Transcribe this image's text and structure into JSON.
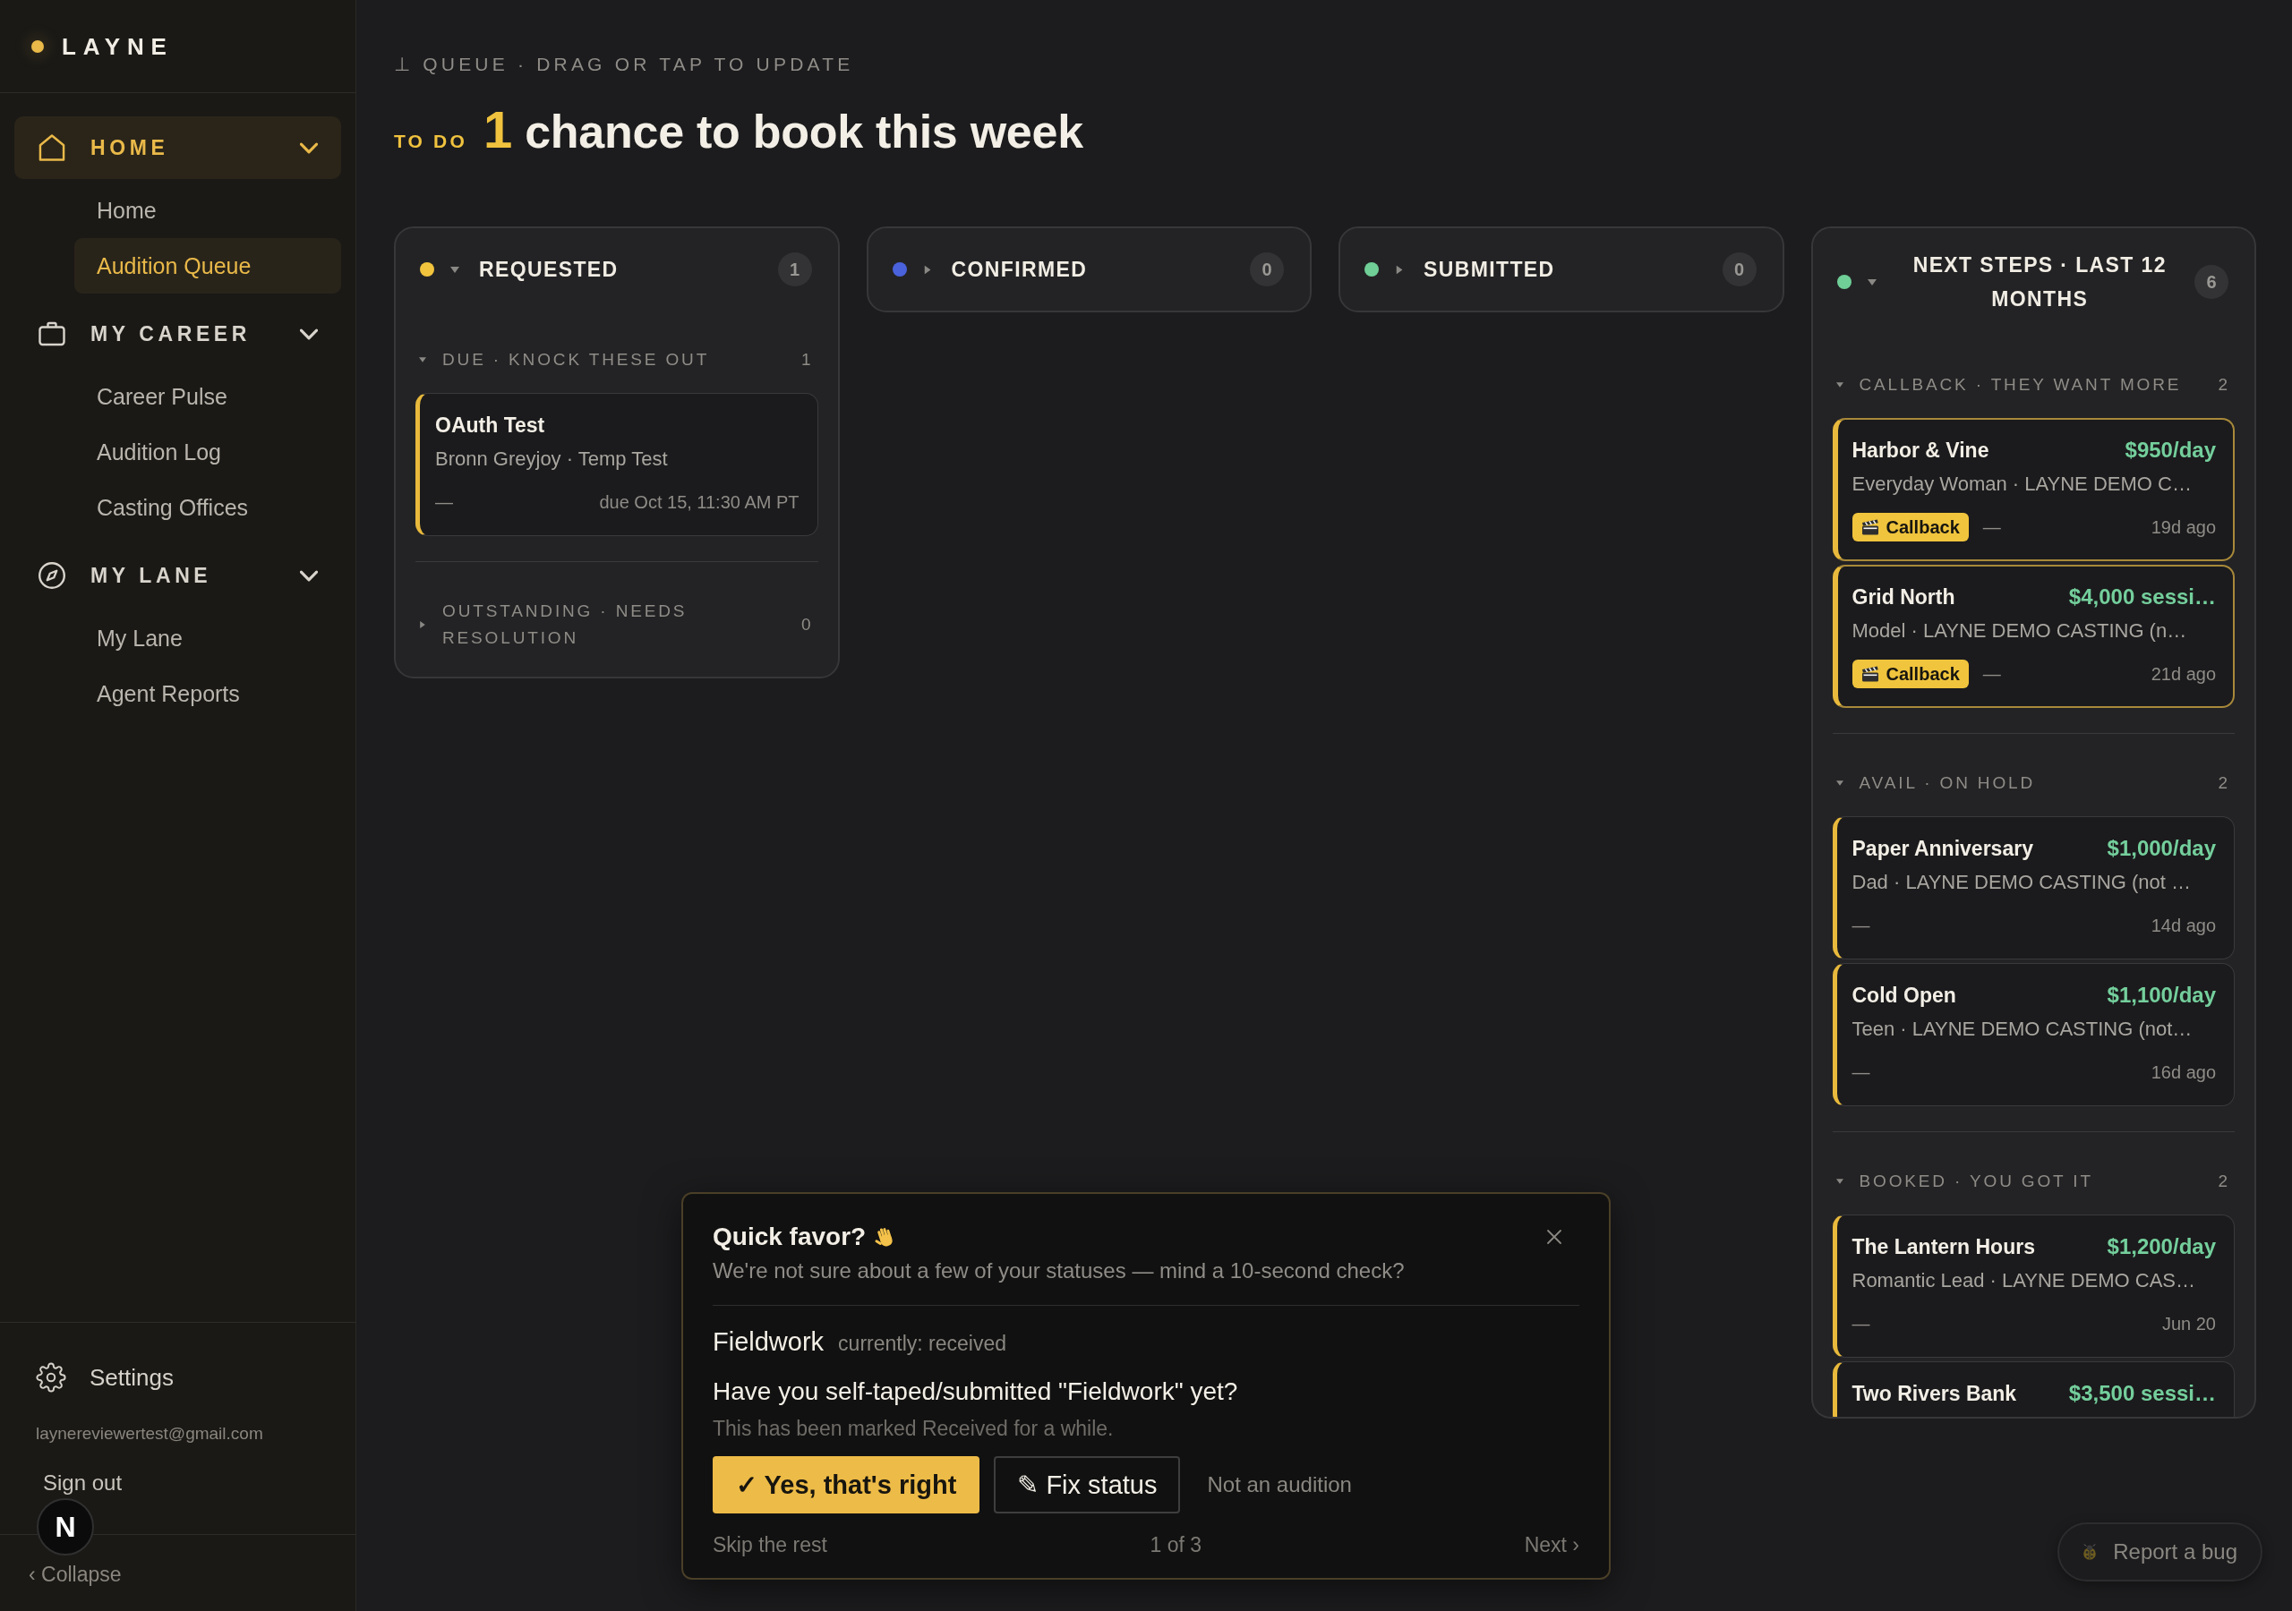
{
  "sidebar": {
    "brand": "LAYNE",
    "groups": [
      {
        "label": "HOME",
        "active": true,
        "expanded": true,
        "items": [
          {
            "label": "Home",
            "selected": false
          },
          {
            "label": "Audition Queue",
            "selected": true
          }
        ]
      },
      {
        "label": "MY CAREER",
        "active": false,
        "expanded": true,
        "items": [
          {
            "label": "Career Pulse",
            "selected": false
          },
          {
            "label": "Audition Log",
            "selected": false
          },
          {
            "label": "Casting Offices",
            "selected": false
          }
        ]
      },
      {
        "label": "MY LANE",
        "active": false,
        "expanded": true,
        "items": [
          {
            "label": "My Lane",
            "selected": false
          },
          {
            "label": "Agent Reports",
            "selected": false
          }
        ]
      }
    ],
    "settings": "Settings",
    "email": "laynereviewertest@gmail.com",
    "sign_out": "Sign out",
    "collapse": "‹ Collapse"
  },
  "queue": {
    "eyebrow": "⊥ QUEUE · DRAG OR TAP TO UPDATE",
    "todo_label": "TO DO",
    "count": "1",
    "headline": "chance to book this week",
    "columns": [
      {
        "title": "REQUESTED",
        "color": "#f2c43d",
        "expanded": true,
        "count": "1",
        "sections": [
          {
            "label": "DUE · KNOCK THESE OUT",
            "count": "1",
            "expanded": true,
            "cards": [
              {
                "title": "OAuth Test",
                "subtitle": "Bronn Greyjoy · Temp Test",
                "note": "—",
                "time": "due Oct 15, 11:30 AM PT",
                "highlighted": false
              }
            ]
          },
          {
            "label": "OUTSTANDING · NEEDS RESOLUTION",
            "count": "0",
            "expanded": false
          }
        ]
      },
      {
        "title": "CONFIRMED",
        "color": "#4a62dc",
        "expanded": false,
        "count": "0"
      },
      {
        "title": "SUBMITTED",
        "color": "#6fcf97",
        "expanded": false,
        "count": "0"
      },
      {
        "title": "NEXT STEPS · LAST 12 MONTHS",
        "color": "#6fcf97",
        "expanded": true,
        "count": "6",
        "sections": [
          {
            "label": "CALLBACK · THEY WANT MORE",
            "count": "2",
            "expanded": true,
            "cards": [
              {
                "title": "Harbor & Vine",
                "rate": "$950/day",
                "subtitle": "Everyday Woman · LAYNE DEMO C…",
                "badge": "Callback",
                "note": "—",
                "time": "19d ago",
                "highlighted": true
              },
              {
                "title": "Grid North",
                "rate": "$4,000 sessi…",
                "subtitle": "Model · LAYNE DEMO CASTING (n…",
                "badge": "Callback",
                "note": "—",
                "time": "21d ago",
                "highlighted": true
              }
            ]
          },
          {
            "label": "AVAIL · ON HOLD",
            "count": "2",
            "expanded": true,
            "cards": [
              {
                "title": "Paper Anniversary",
                "rate": "$1,000/day",
                "subtitle": "Dad · LAYNE DEMO CASTING (not …",
                "note": "—",
                "time": "14d ago",
                "highlighted": false
              },
              {
                "title": "Cold Open",
                "rate": "$1,100/day",
                "subtitle": "Teen · LAYNE DEMO CASTING (not…",
                "note": "—",
                "time": "16d ago",
                "highlighted": false
              }
            ]
          },
          {
            "label": "BOOKED · YOU GOT IT",
            "count": "2",
            "expanded": true,
            "cards": [
              {
                "title": "The Lantern Hours",
                "rate": "$1,200/day",
                "subtitle": "Romantic Lead · LAYNE DEMO CAS…",
                "note": "—",
                "time": "Jun 20",
                "highlighted": false
              },
              {
                "title": "Two Rivers Bank",
                "rate": "$3,500 sessi…",
                "highlighted": false
              }
            ]
          }
        ]
      }
    ]
  },
  "review_prompt": {
    "title": "Quick favor?",
    "subtitle": "We're not sure about a few of your statuses — mind a 10-second check?",
    "item_name": "Fieldwork",
    "item_status": "currently: received",
    "question": "Have you self-taped/submitted \"Fieldwork\" yet?",
    "note": "This has been marked Received for a while.",
    "actions": [
      {
        "label": "✓ Yes, that's right",
        "kind": "primary"
      },
      {
        "label": "✎ Fix status",
        "kind": "outline"
      },
      {
        "label": "Not an audition",
        "kind": "link"
      }
    ],
    "skip": "Skip the rest",
    "progress": "1 of 3",
    "next": "Next ›"
  },
  "report_bug": "Report a bug",
  "dev_indicator": "N"
}
